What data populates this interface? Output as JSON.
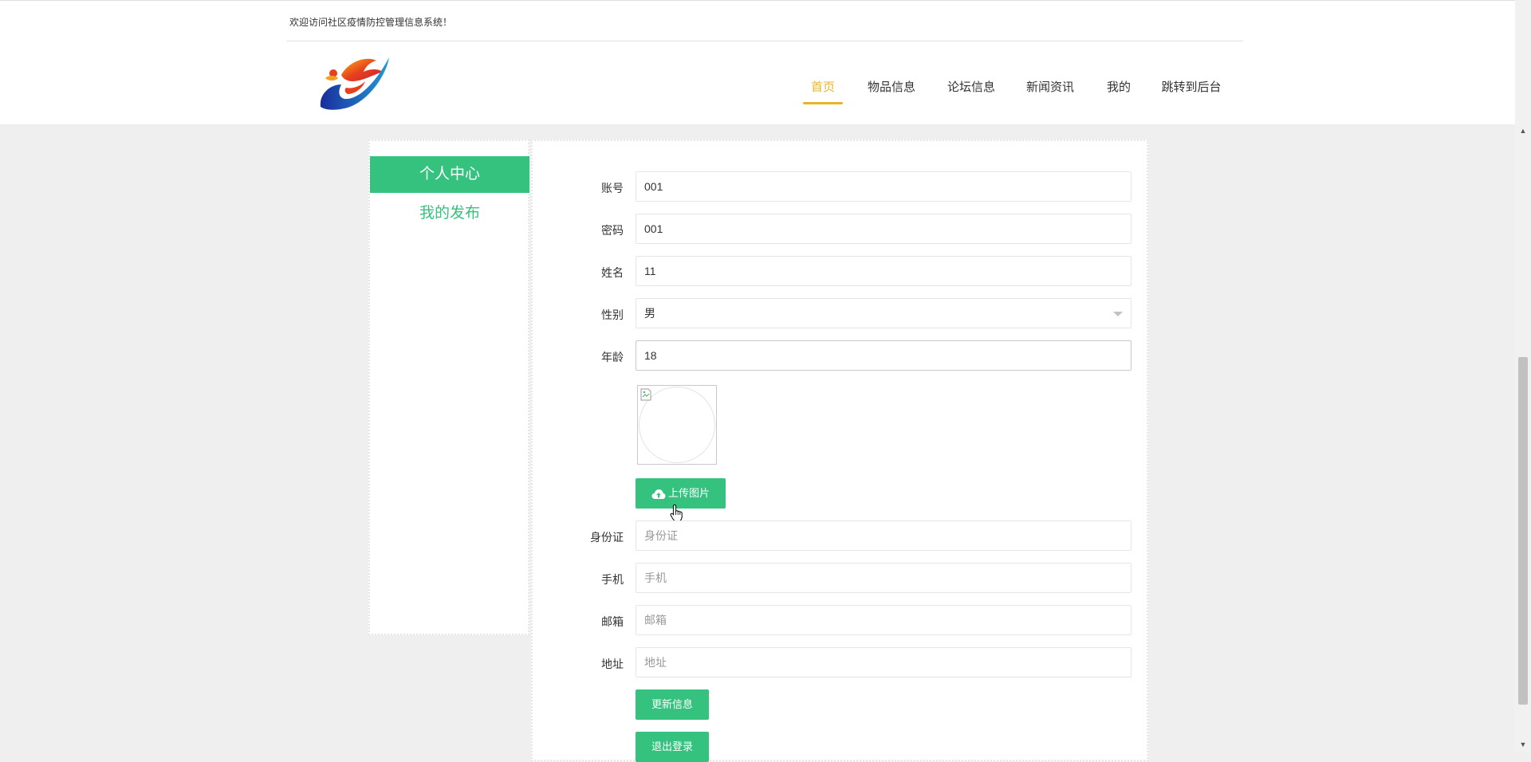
{
  "header": {
    "welcome": "欢迎访问社区疫情防控管理信息系统！",
    "nav": [
      {
        "label": "首页",
        "active": true
      },
      {
        "label": "物品信息",
        "active": false
      },
      {
        "label": "论坛信息",
        "active": false
      },
      {
        "label": "新闻资讯",
        "active": false
      },
      {
        "label": "我的",
        "active": false
      },
      {
        "label": "跳转到后台",
        "active": false
      }
    ],
    "accent_color": "#e6b32a"
  },
  "sidebar": {
    "items": [
      {
        "label": "个人中心",
        "active": true
      },
      {
        "label": "我的发布",
        "active": false
      }
    ],
    "accent_color": "#34c27e"
  },
  "form": {
    "account": {
      "label": "账号",
      "value": "001"
    },
    "password": {
      "label": "密码",
      "value": "001"
    },
    "name": {
      "label": "姓名",
      "value": "11"
    },
    "gender": {
      "label": "性别",
      "value": "男"
    },
    "age": {
      "label": "年龄",
      "value": "18"
    },
    "upload_label": "上传图片",
    "id_card": {
      "label": "身份证",
      "placeholder": "身份证",
      "value": ""
    },
    "phone": {
      "label": "手机",
      "placeholder": "手机",
      "value": ""
    },
    "email": {
      "label": "邮箱",
      "placeholder": "邮箱",
      "value": ""
    },
    "address": {
      "label": "地址",
      "placeholder": "地址",
      "value": ""
    },
    "update_label": "更新信息",
    "logout_label": "退出登录"
  }
}
